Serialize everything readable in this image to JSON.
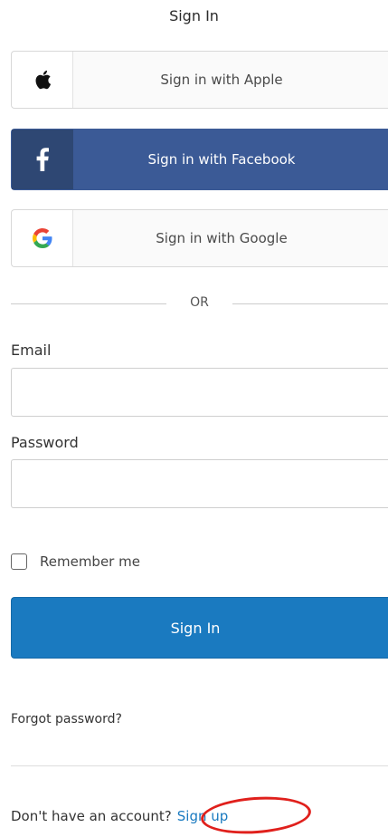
{
  "header": {
    "title": "Sign In"
  },
  "sso": {
    "apple": {
      "label": "Sign in with Apple",
      "icon": "apple-icon"
    },
    "facebook": {
      "label": "Sign in with Facebook",
      "icon": "facebook-icon"
    },
    "google": {
      "label": "Sign in with Google",
      "icon": "google-icon"
    }
  },
  "divider": {
    "text": "OR"
  },
  "form": {
    "email": {
      "label": "Email",
      "value": "",
      "placeholder": ""
    },
    "password": {
      "label": "Password",
      "value": "",
      "placeholder": ""
    },
    "remember": {
      "label": "Remember me",
      "checked": false
    },
    "submit_label": "Sign In"
  },
  "links": {
    "forgot": "Forgot password?",
    "no_account": "Don't have an account?",
    "signup": "Sign up"
  },
  "colors": {
    "facebook": "#3b5a96",
    "primary": "#1a7ac0",
    "highlight": "#e0201c"
  }
}
